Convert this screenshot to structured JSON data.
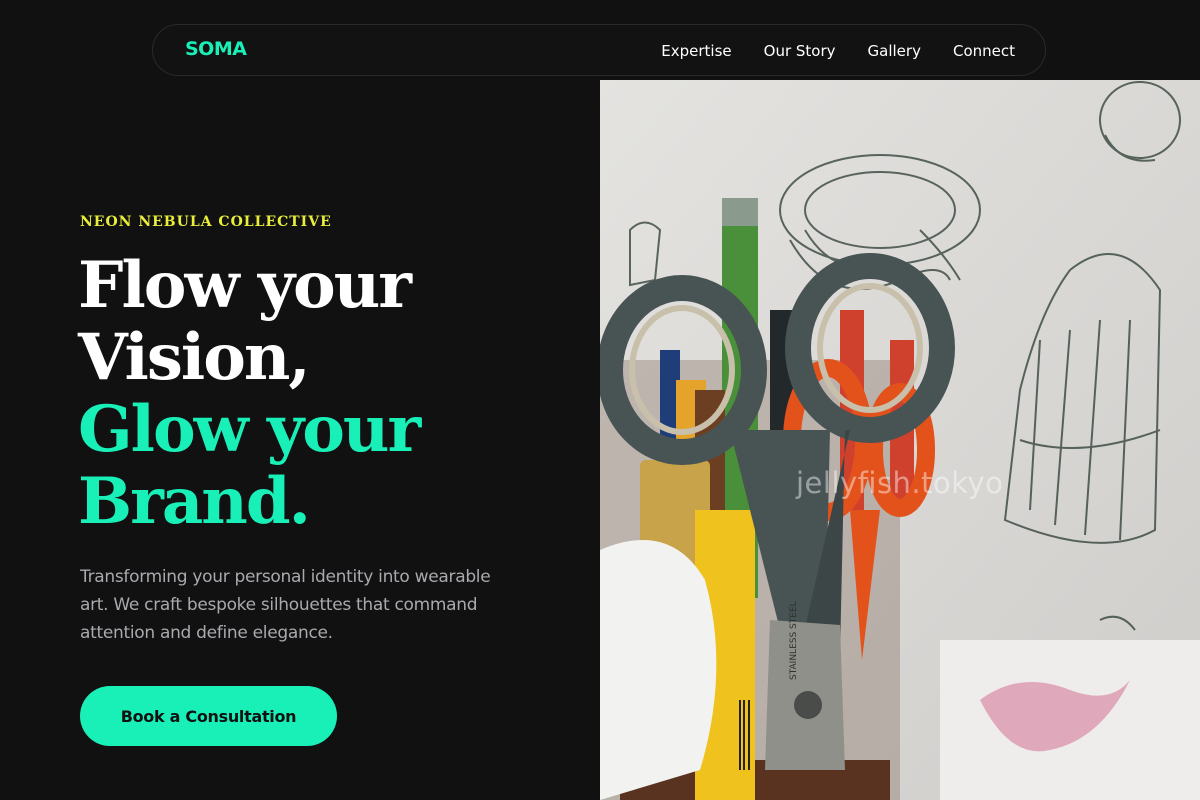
{
  "brand": {
    "logo": "SOMA"
  },
  "nav": {
    "items": [
      "Expertise",
      "Our Story",
      "Gallery",
      "Connect"
    ]
  },
  "hero": {
    "eyebrow": "NEON NEBULA COLLECTIVE",
    "headline_line1": "Flow your",
    "headline_line2": "Vision,",
    "headline_line3": "Glow your",
    "headline_line4": "Brand.",
    "description": "Transforming your personal identity into wearable art. We craft bespoke silhouettes that command attention and define elegance.",
    "cta_label": "Book a Consultation"
  },
  "image": {
    "watermark": "jellyfish.tokyo",
    "scissors_blade_text": "STAINLESS STEEL"
  },
  "colors": {
    "accent": "#19f0b8",
    "eyebrow": "#e8ee3a",
    "background": "#111112",
    "muted_text": "#a9a9ae"
  }
}
